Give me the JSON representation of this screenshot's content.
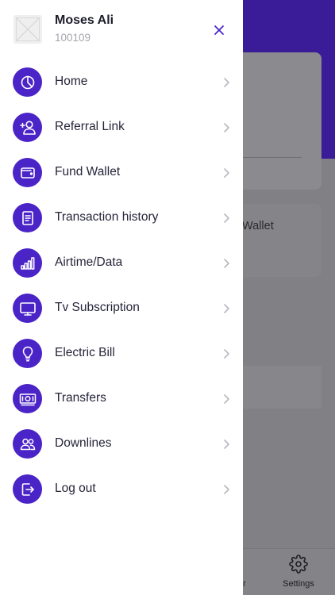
{
  "background": {
    "card_text": "Wallet",
    "bottom_tabs": {
      "partial_label": "er",
      "settings_label": "Settings"
    }
  },
  "drawer": {
    "user": {
      "name": "Moses Ali",
      "id": "100109"
    },
    "menu": [
      {
        "label": "Home",
        "icon": "pie-chart-icon"
      },
      {
        "label": "Referral Link",
        "icon": "add-user-icon"
      },
      {
        "label": "Fund Wallet",
        "icon": "wallet-icon"
      },
      {
        "label": "Transaction history",
        "icon": "receipt-icon"
      },
      {
        "label": "Airtime/Data",
        "icon": "signal-bars-icon"
      },
      {
        "label": "Tv Subscription",
        "icon": "tv-icon"
      },
      {
        "label": "Electric Bill",
        "icon": "lightbulb-icon"
      },
      {
        "label": "Transfers",
        "icon": "cash-icon"
      },
      {
        "label": "Downlines",
        "icon": "users-icon"
      },
      {
        "label": "Log out",
        "icon": "logout-icon"
      }
    ]
  },
  "colors": {
    "accent": "#4b24c7",
    "header_purple": "#3a1b98",
    "chevron": "#b8b8c0"
  }
}
